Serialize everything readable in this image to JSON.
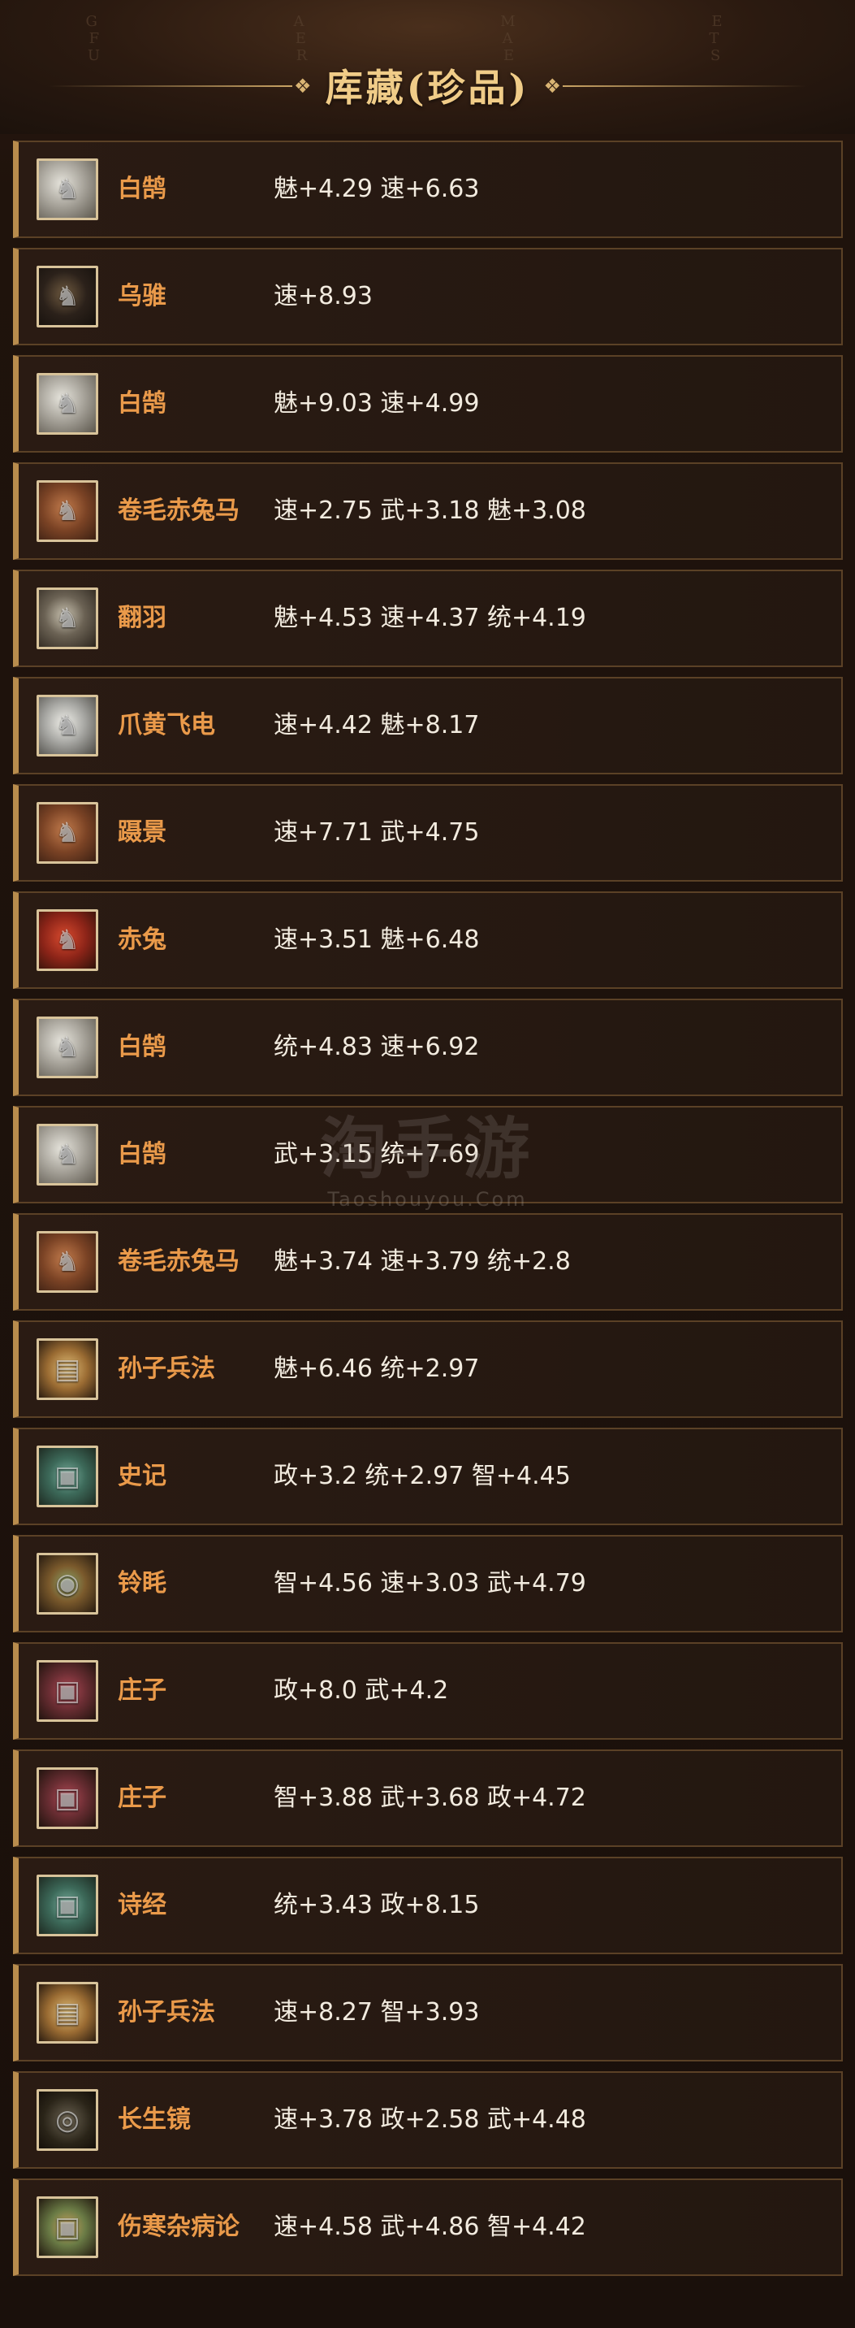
{
  "header": {
    "background_text": "G A M E   F E A T U R E S",
    "title": "库藏(珍品)"
  },
  "items": [
    {
      "name": "白鹄",
      "stats": "魅+4.29 速+6.63",
      "icon": "white-horse-icon"
    },
    {
      "name": "乌骓",
      "stats": "速+8.93",
      "icon": "black-horse-icon"
    },
    {
      "name": "白鹄",
      "stats": "魅+9.03 速+4.99",
      "icon": "white-horse-icon"
    },
    {
      "name": "卷毛赤兔马",
      "stats": "速+2.75 武+3.18 魅+3.08",
      "icon": "brown-horse-icon"
    },
    {
      "name": "翻羽",
      "stats": "魅+4.53 速+4.37 统+4.19",
      "icon": "armored-horse-icon"
    },
    {
      "name": "爪黄飞电",
      "stats": "速+4.42 魅+8.17",
      "icon": "silver-horse-icon"
    },
    {
      "name": "蹑景",
      "stats": "速+7.71 武+4.75",
      "icon": "brown-horse-icon"
    },
    {
      "name": "赤兔",
      "stats": "速+3.51 魅+6.48",
      "icon": "red-horse-icon"
    },
    {
      "name": "白鹄",
      "stats": "统+4.83 速+6.92",
      "icon": "white-horse-icon"
    },
    {
      "name": "白鹄",
      "stats": "武+3.15 统+7.69",
      "icon": "white-horse-icon"
    },
    {
      "name": "卷毛赤兔马",
      "stats": "魅+3.74 速+3.79 统+2.8",
      "icon": "brown-horse-icon"
    },
    {
      "name": "孙子兵法",
      "stats": "魅+6.46 统+2.97",
      "icon": "scroll-icon"
    },
    {
      "name": "史记",
      "stats": "政+3.2 统+2.97 智+4.45",
      "icon": "book-icon"
    },
    {
      "name": "铃眊",
      "stats": "智+4.56 速+3.03 武+4.79",
      "icon": "bell-icon"
    },
    {
      "name": "庄子",
      "stats": "政+8.0 武+4.2",
      "icon": "book-icon"
    },
    {
      "name": "庄子",
      "stats": "智+3.88 武+3.68 政+4.72",
      "icon": "book-icon"
    },
    {
      "name": "诗经",
      "stats": "统+3.43 政+8.15",
      "icon": "book-icon"
    },
    {
      "name": "孙子兵法",
      "stats": "速+8.27 智+3.93",
      "icon": "scroll-icon"
    },
    {
      "name": "长生镜",
      "stats": "速+3.78 政+2.58 武+4.48",
      "icon": "mirror-icon"
    },
    {
      "name": "伤寒杂病论",
      "stats": "速+4.58 武+4.86 智+4.42",
      "icon": "book-box-icon"
    }
  ],
  "watermark": {
    "main": "淘手游",
    "sub": "Taoshouyou.Com"
  }
}
